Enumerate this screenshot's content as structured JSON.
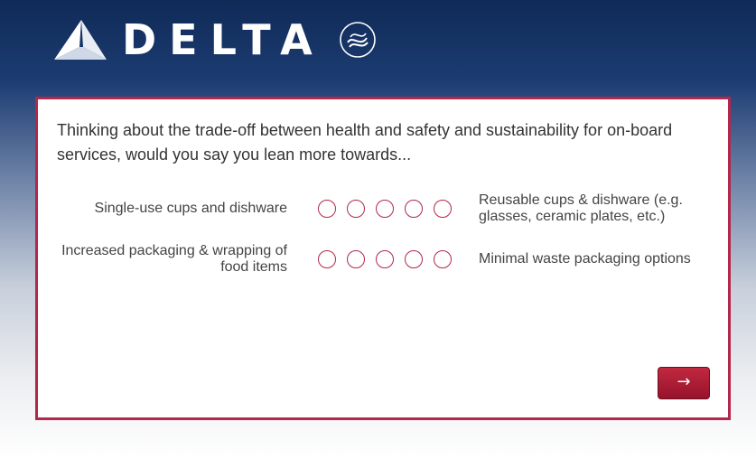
{
  "brand": {
    "name": "DELTA",
    "alliance": "SKYTEAM"
  },
  "question": {
    "text": "Thinking about the trade-off between health and safety and sustainability for on-board services, would you say you lean more towards..."
  },
  "scale_rows": [
    {
      "left_label": "Single-use cups and dishware",
      "right_label": "Reusable cups & dishware (e.g. glasses, ceramic plates, etc.)",
      "points": 5,
      "selected": null
    },
    {
      "left_label": "Increased packaging & wrapping of food items",
      "right_label": "Minimal waste packaging options",
      "points": 5,
      "selected": null
    }
  ],
  "navigation": {
    "next_label": "→"
  },
  "colors": {
    "accent": "#b2274a",
    "button": "#a81b32",
    "header_dark": "#0f2a57"
  }
}
